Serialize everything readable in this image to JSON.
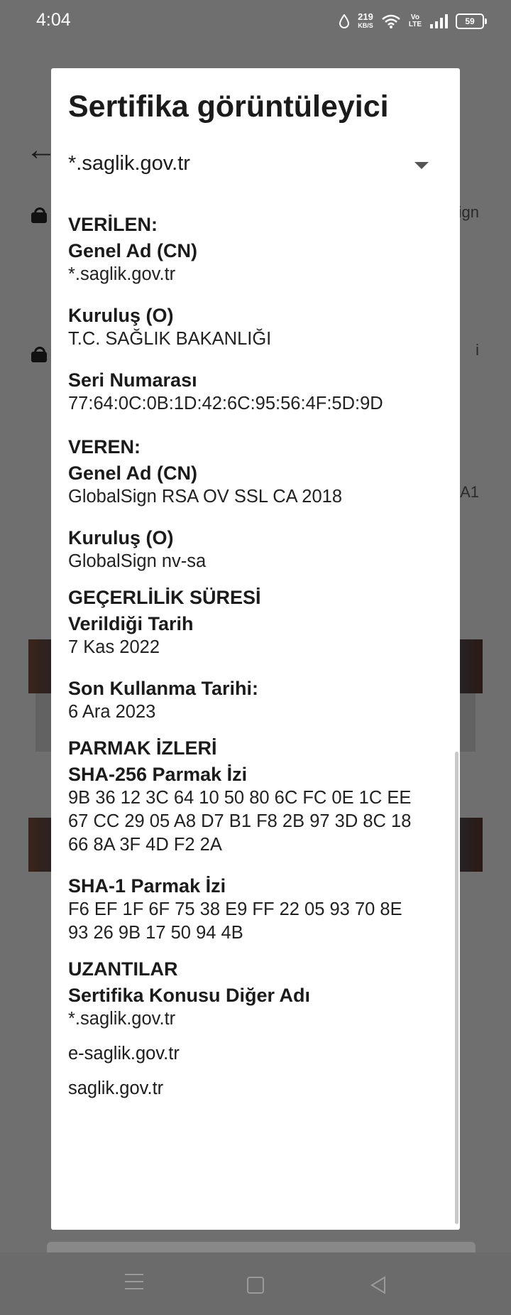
{
  "status_bar": {
    "time": "4:04",
    "net_speed_value": "219",
    "net_speed_unit": "KB/S",
    "volte_top": "Vo",
    "volte_bottom": "LTE",
    "battery": "59"
  },
  "background": {
    "partial_text_1": "ign",
    "partial_text_2": "i",
    "partial_text_3": "A1"
  },
  "dialog": {
    "title": "Sertifika görüntüleyici",
    "selected_certificate": "*.saglik.gov.tr",
    "issued_to": {
      "heading": "VERİLEN:",
      "cn_label": "Genel Ad (CN)",
      "cn_value": "*.saglik.gov.tr",
      "o_label": "Kuruluş (O)",
      "o_value": "T.C. SAĞLIK BAKANLIĞI",
      "serial_label": "Seri Numarası",
      "serial_value": "77:64:0C:0B:1D:42:6C:95:56:4F:5D:9D"
    },
    "issued_by": {
      "heading": "VEREN:",
      "cn_label": "Genel Ad (CN)",
      "cn_value": "GlobalSign RSA OV SSL CA 2018",
      "o_label": "Kuruluş (O)",
      "o_value": "GlobalSign nv-sa"
    },
    "validity": {
      "heading": "GEÇERLİLİK SÜRESİ",
      "issued_label": "Verildiği Tarih",
      "issued_value": "7 Kas 2022",
      "expires_label": "Son Kullanma Tarihi:",
      "expires_value": "6 Ara 2023"
    },
    "fingerprints": {
      "heading": "PARMAK İZLERİ",
      "sha256_label": "SHA-256 Parmak İzi",
      "sha256_value": "9B 36 12 3C 64 10 50 80 6C FC 0E 1C EE\n67 CC 29 05 A8 D7 B1 F8 2B 97 3D 8C 18\n66 8A 3F 4D F2 2A",
      "sha1_label": "SHA-1 Parmak İzi",
      "sha1_value": "F6 EF 1F 6F 75 38 E9 FF 22 05 93 70 8E\n93 26 9B 17 50 94 4B"
    },
    "extensions": {
      "heading": "UZANTILAR",
      "san_label": "Sertifika Konusu Diğer Adı",
      "san_values": [
        "*.saglik.gov.tr",
        "e-saglik.gov.tr",
        "saglik.gov.tr"
      ]
    }
  }
}
